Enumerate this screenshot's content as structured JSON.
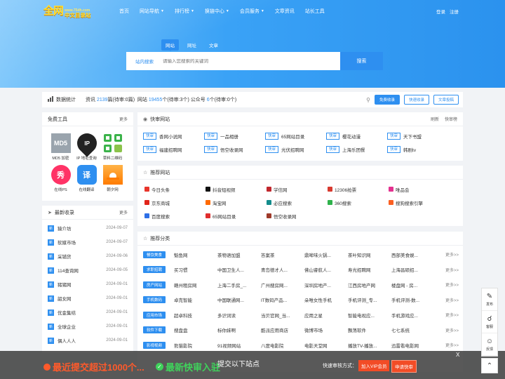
{
  "logo": {
    "big": "全网",
    "url": "www.75dh.com",
    "cn": "中文目录站"
  },
  "nav": [
    {
      "label": "首页",
      "caret": false
    },
    {
      "label": "网站导航",
      "caret": true
    },
    {
      "label": "排行榜",
      "caret": true
    },
    {
      "label": "换链中心",
      "caret": true
    },
    {
      "label": "会员服务",
      "caret": true
    },
    {
      "label": "文章资讯",
      "caret": false
    },
    {
      "label": "站长工具",
      "caret": false
    }
  ],
  "auth": {
    "login": "登录",
    "register": "注册"
  },
  "search": {
    "tabs": [
      "网站",
      "网址",
      "文章"
    ],
    "scope": "站内搜索",
    "placeholder": "请输入您搜索的关键词",
    "button": "搜索"
  },
  "stats": {
    "label": "数据统计",
    "zixun_label": "资讯",
    "zixun_num": "2139",
    "zixun_pending": "篇(待审:0篇)",
    "site_label": "网站",
    "site_num": "19455",
    "site_pending": "个(待审:3个)",
    "gzh_label": "公众号",
    "gzh_num": "6",
    "gzh_pending": "个(待审:0个)",
    "btn_free": "免费收录",
    "btn_fast": "快速收录",
    "btn_article": "文章投稿"
  },
  "tools": {
    "title": "免费工具",
    "more": "更多",
    "items": [
      {
        "label": "MD5 加密",
        "icon": "MD5"
      },
      {
        "label": "IP 地址查询",
        "icon": "IP"
      },
      {
        "label": "草料二维码",
        "icon": ""
      },
      {
        "label": "在线PS",
        "icon": "秀"
      },
      {
        "label": "在线翻译",
        "icon": "译"
      },
      {
        "label": "朝夕网",
        "icon": ""
      }
    ]
  },
  "latest": {
    "title": "最新收录",
    "more": "更多",
    "badge": "新",
    "items": [
      {
        "name": "猿介坊",
        "date": "2024-09-07"
      },
      {
        "name": "软媒市场",
        "date": "2024-09-07"
      },
      {
        "name": "采铺货",
        "date": "2024-09-06"
      },
      {
        "name": "114查询网",
        "date": "2024-09-05"
      },
      {
        "name": "猪猪网",
        "date": "2024-09-01"
      },
      {
        "name": "韶女网",
        "date": "2024-09-01"
      },
      {
        "name": "优金集结",
        "date": "2024-09-01"
      },
      {
        "name": "全球企业",
        "date": "2024-09-01"
      },
      {
        "name": "偶人人人",
        "date": "2024-09-01"
      }
    ]
  },
  "quick": {
    "title": "快审网站",
    "refresh": "刷新",
    "rank": "快审榜",
    "tag": "快审",
    "items": [
      "香网小说网",
      "一品相册",
      "65网站目录",
      "樱花动漫",
      "天下书盟",
      "福建招聘网",
      "悟空收录网",
      "光伏招聘网",
      "上海乐团餐",
      "韩剧tv"
    ]
  },
  "recommend": {
    "title": "推荐网站",
    "items": [
      {
        "name": "今日头条",
        "color": "#e8352b"
      },
      {
        "name": "抖音短视频",
        "color": "#111111"
      },
      {
        "name": "学信网",
        "color": "#c1272d"
      },
      {
        "name": "12306抢票",
        "color": "#d83a2f"
      },
      {
        "name": "唯品会",
        "color": "#e3318f"
      },
      {
        "name": "京东商城",
        "color": "#e1251b"
      },
      {
        "name": "淘宝网",
        "color": "#ff6a00"
      },
      {
        "name": "必应搜索",
        "color": "#138c8c"
      },
      {
        "name": "360搜索",
        "color": "#2fb24c"
      },
      {
        "name": "搜狗搜索引擎",
        "color": "#fb6022"
      },
      {
        "name": "百度搜索",
        "color": "#2e6fe6"
      },
      {
        "name": "65网站目录",
        "color": "#e02e2e"
      },
      {
        "name": "悟空收录网",
        "color": "#9e3a2a"
      }
    ]
  },
  "categories": {
    "title": "推荐分类",
    "more": "更多>>",
    "rows": [
      {
        "tag": "餐饮美食",
        "items": [
          "魁鱼网",
          "茶物语加盟",
          "答案茶",
          "鼎哞味火锅...",
          "茶叶知识网",
          "西部美食娱..."
        ]
      },
      {
        "tag": "求职招聘",
        "items": [
          "买习惯",
          "中国卫生人...",
          "青岛德才人...",
          "佛山睿航人...",
          "寿光招聘网",
          "上海昌硕招..."
        ]
      },
      {
        "tag": "房产网站",
        "items": [
          "赣州租房网",
          "上海二手房_...",
          "广州搜房网...",
          "深圳房地产...",
          "江西房地产网",
          "楼盘网 - 房..."
        ]
      },
      {
        "tag": "手机数码",
        "items": [
          "卓克智能",
          "中国联通网...",
          "IT数码产品...",
          "朵唯女性手机",
          "手机评测_专...",
          "手机评测-数..."
        ]
      },
      {
        "tag": "应用市场",
        "items": [
          "超卓科技",
          "多识词读",
          "当贝官网_当...",
          "应用之星",
          "智能电视应...",
          "手机游戏应..."
        ]
      },
      {
        "tag": "软件下载",
        "items": [
          "搜盘盘",
          "标你妹啊",
          "酷派应用商店",
          "微博市场",
          "飘荡软件",
          "七七系统"
        ]
      },
      {
        "tag": "影视视频",
        "items": [
          "熊猫影院",
          "91视频网站",
          "八度电影院",
          "电影天堂网",
          "播放TV-播放...",
          "迅雷看电影网"
        ]
      }
    ]
  },
  "float": {
    "post": "发布",
    "service": "客服",
    "feedback": "反馈"
  },
  "overlay": {
    "left": "最近提交超过1000个...",
    "mid": "最新快审入驻",
    "mid2": "提交以下站点",
    "label": "快速审核方式：",
    "vip": "加入VIP会员",
    "vip_fast": "申请快审",
    "close": "X"
  }
}
